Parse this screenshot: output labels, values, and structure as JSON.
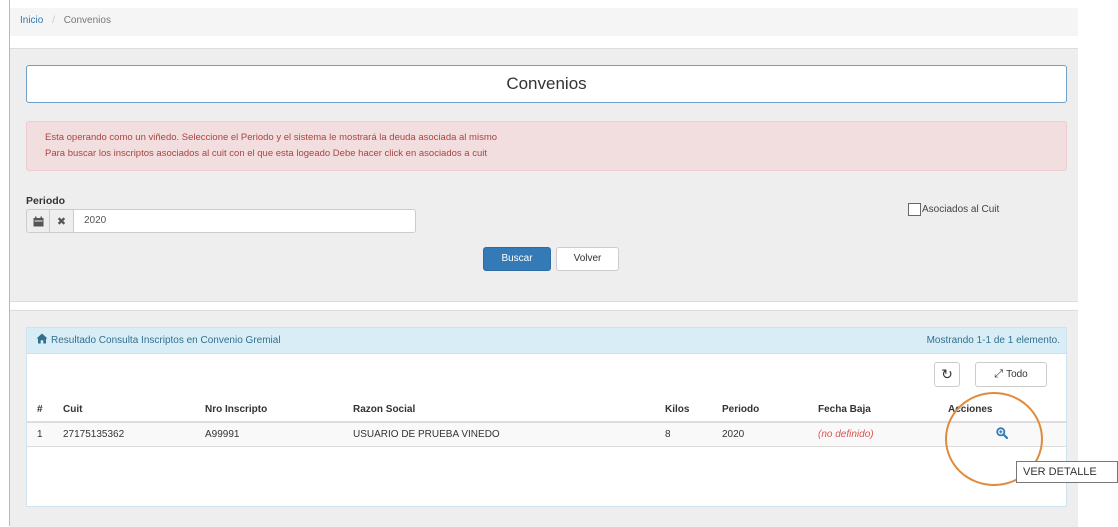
{
  "breadcrumb": {
    "home": "Inicio",
    "current": "Convenios"
  },
  "page": {
    "title": "Convenios"
  },
  "alert": {
    "line1": "Esta operando como un viñedo. Seleccione el Periodo y el sistema le mostrará la deuda asociada al mismo",
    "line2": "Para buscar los inscriptos asociados al cuit con el que esta logeado Debe hacer click en asociados a cuit"
  },
  "filter": {
    "periodo_label": "Periodo",
    "periodo_value": "2020",
    "asociados_label": "Asociados al Cuit",
    "asociados_checked": false
  },
  "buttons": {
    "search": "Buscar",
    "back": "Volver"
  },
  "results": {
    "heading": "Resultado Consulta Inscriptos en Convenio Gremial",
    "count_text": "Mostrando 1-1 de 1 elemento.",
    "todo_label": "Todo",
    "columns": [
      "#",
      "Cuit",
      "Nro Inscripto",
      "Razon Social",
      "Kilos",
      "Periodo",
      "Fecha Baja",
      "Acciones"
    ],
    "rows": [
      {
        "num": "1",
        "cuit": "27175135362",
        "nro_inscripto": "A99991",
        "razon_social": "USUARIO DE PRUEBA VINEDO",
        "kilos": "8",
        "periodo": "2020",
        "fecha_baja": "(no definido)"
      }
    ]
  },
  "tooltip": {
    "text": "VER DETALLE"
  },
  "icons": {
    "home": "home-icon",
    "calendar": "calendar-icon",
    "clear": "close-icon",
    "refresh": "refresh-icon",
    "expand": "expand-icon",
    "detail": "zoom-icon"
  },
  "colors": {
    "primary": "#337ab7",
    "alert_text": "#a94442",
    "alert_bg": "#f2dede",
    "info_bg": "#d9edf7",
    "undefined_text": "#d9534f",
    "highlight": "#e08a3c"
  }
}
